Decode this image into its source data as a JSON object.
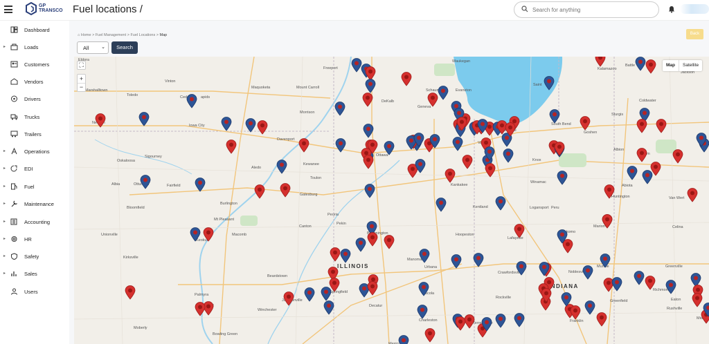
{
  "header": {
    "logo_text_line1": "GP",
    "logo_text_line2": "TRANSCO",
    "page_title": "Fuel locations /",
    "search_placeholder": "Search for anything"
  },
  "sidebar": {
    "items": [
      {
        "label": "Dashboard",
        "icon": "dashboard-icon",
        "caret": false
      },
      {
        "label": "Loads",
        "icon": "loads-icon",
        "caret": true
      },
      {
        "label": "Customers",
        "icon": "customers-icon",
        "caret": false
      },
      {
        "label": "Vendors",
        "icon": "vendors-icon",
        "caret": false
      },
      {
        "label": "Drivers",
        "icon": "drivers-icon",
        "caret": false
      },
      {
        "label": "Trucks",
        "icon": "truck-icon",
        "caret": false
      },
      {
        "label": "Trailers",
        "icon": "trailer-icon",
        "caret": false
      },
      {
        "label": "Operations",
        "icon": "operations-icon",
        "caret": true
      },
      {
        "label": "EDI",
        "icon": "edi-icon",
        "caret": true
      },
      {
        "label": "Fuel",
        "icon": "fuel-icon",
        "caret": true
      },
      {
        "label": "Maintenance",
        "icon": "maintenance-icon",
        "caret": true
      },
      {
        "label": "Accounting",
        "icon": "accounting-icon",
        "caret": true
      },
      {
        "label": "HR",
        "icon": "hr-icon",
        "caret": true
      },
      {
        "label": "Safety",
        "icon": "safety-icon",
        "caret": true
      },
      {
        "label": "Sales",
        "icon": "sales-icon",
        "caret": true
      },
      {
        "label": "Users",
        "icon": "users-icon",
        "caret": false
      }
    ]
  },
  "breadcrumb": {
    "home": "Home",
    "sep": ">",
    "level1": "Fuel Management",
    "level2": "Fuel Locations",
    "current": "Map"
  },
  "toolbar": {
    "filter_value": "All",
    "search_label": "Search",
    "back_label": "Back"
  },
  "map": {
    "type_map": "Map",
    "type_satellite": "Satellite",
    "zoom_in": "+",
    "zoom_out": "−",
    "state_labels": [
      "ILLINOIS",
      "INDIANA"
    ],
    "place_labels": [
      "Eldora",
      "Freeport",
      "Waukegan",
      "Battle",
      "Kalamazoo",
      "Jackson",
      "Marshalltown",
      "Toledo",
      "Vinton",
      "Maquoketa",
      "Mount Carroll",
      "DeKalb",
      "Schaum",
      "Evanston",
      "Saint",
      "Cedar",
      "apids",
      "Geneva",
      "Morrison",
      "Coldwater",
      "Newton",
      "Iowa City",
      "Davenport",
      "Sturgis",
      "South Bend",
      "Goshen",
      "La Porte",
      "Valp",
      "Sigourney",
      "Kewanee",
      "Ottawa",
      "Aledo",
      "Knox",
      "Albion",
      "Auburn",
      "Oskaloosa",
      "Albia",
      "Ottumwa",
      "Fairfield",
      "Toulon",
      "Galesburg",
      "Kankakee",
      "Winamac",
      "Abiota",
      "Huntington",
      "Van Wert",
      "Bloomfield",
      "Burlington",
      "Mt Pleasant",
      "Peoria",
      "Kentland",
      "Logansport",
      "Peru",
      "Keokuk",
      "Canton",
      "Pekin",
      "Macomb",
      "Bloomington",
      "Hoopeston",
      "Kokomo",
      "Marion",
      "Celina",
      "Unionville",
      "Lafayette",
      "Kirksville",
      "Manomah",
      "Urbana",
      "Crawfordsville",
      "Noblesville",
      "Muncie",
      "Greenville",
      "Beardstown",
      "Decatur",
      "Tuscola",
      "Richmond",
      "Palmyra",
      "Hannibal",
      "Jacksonville",
      "Springfield",
      "Charleston",
      "Rockville",
      "Greenfield",
      "Eaton",
      "Rushville",
      "Middletown",
      "Moberly",
      "Bowling Green",
      "Terre Haute",
      "Franklin",
      "Winchester",
      "Mexico"
    ],
    "pin_colors": {
      "red": "#d5302e",
      "blue": "#2e5596"
    }
  }
}
